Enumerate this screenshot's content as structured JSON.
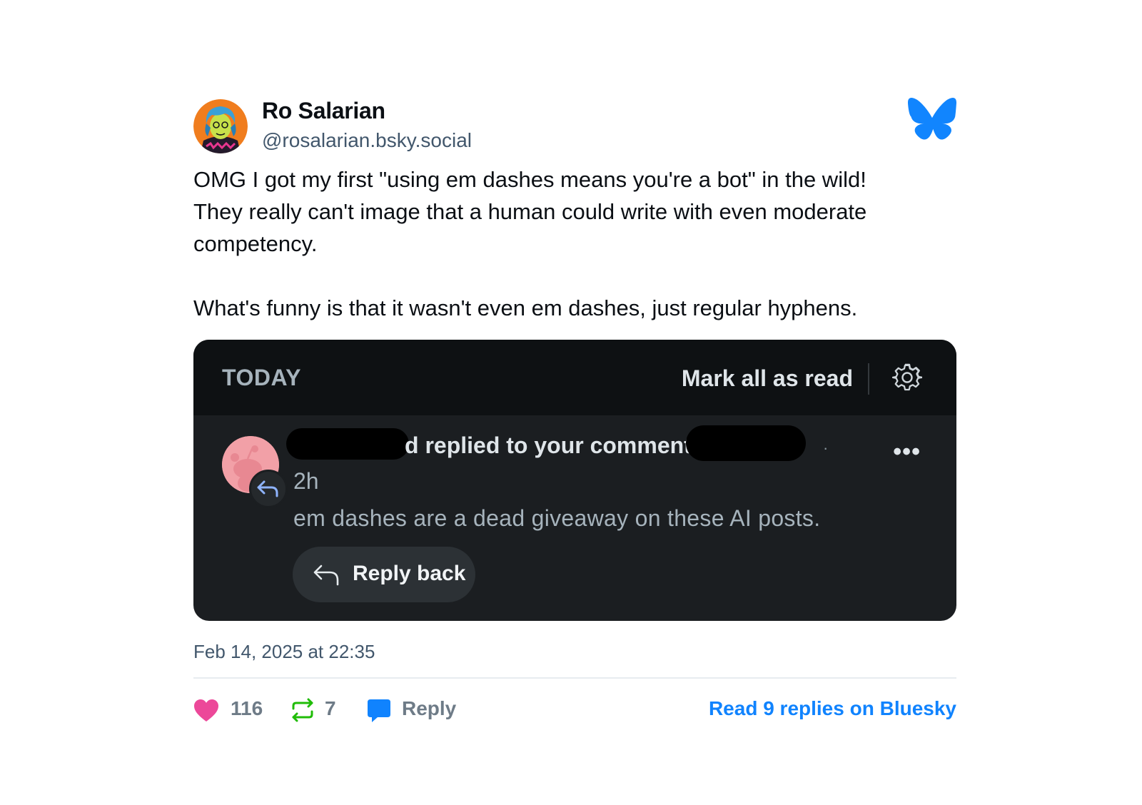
{
  "post": {
    "author_name": "Ro Salarian",
    "author_handle": "@rosalarian.bsky.social",
    "text_lines": [
      "OMG I got my first \"using em dashes means you're a bot\" in the wild!",
      "They really can't image that a human could write with even moderate",
      "competency.",
      "What's funny is that it wasn't even em dashes, just regular hyphens."
    ],
    "timestamp": "Feb 14, 2025 at 22:35",
    "likes": "116",
    "reposts": "7",
    "reply_label": "Reply",
    "read_replies_label": "Read 9 replies on Bluesky"
  },
  "embed": {
    "section_label": "TODAY",
    "mark_all_read": "Mark all as read",
    "notification": {
      "title_fragment_a": "d replied to your comment i",
      "title_fragment_b": "·",
      "time": "2h",
      "body": "em dashes are a dead giveaway on these AI posts.",
      "reply_button": "Reply back"
    }
  },
  "colors": {
    "like": "#ec4899",
    "repost": "#20bc07",
    "reply": "#1083fe",
    "link": "#1083fe",
    "bluesky": "#1185fe",
    "embed_bg": "#1b1e21"
  },
  "icons": {
    "brand": "bluesky-butterfly-icon",
    "settings": "gear-icon",
    "more": "ellipsis-icon",
    "reply_arrow": "reply-arrow-icon",
    "like": "heart-icon",
    "repost": "repost-icon",
    "comment": "speech-bubble-icon"
  }
}
